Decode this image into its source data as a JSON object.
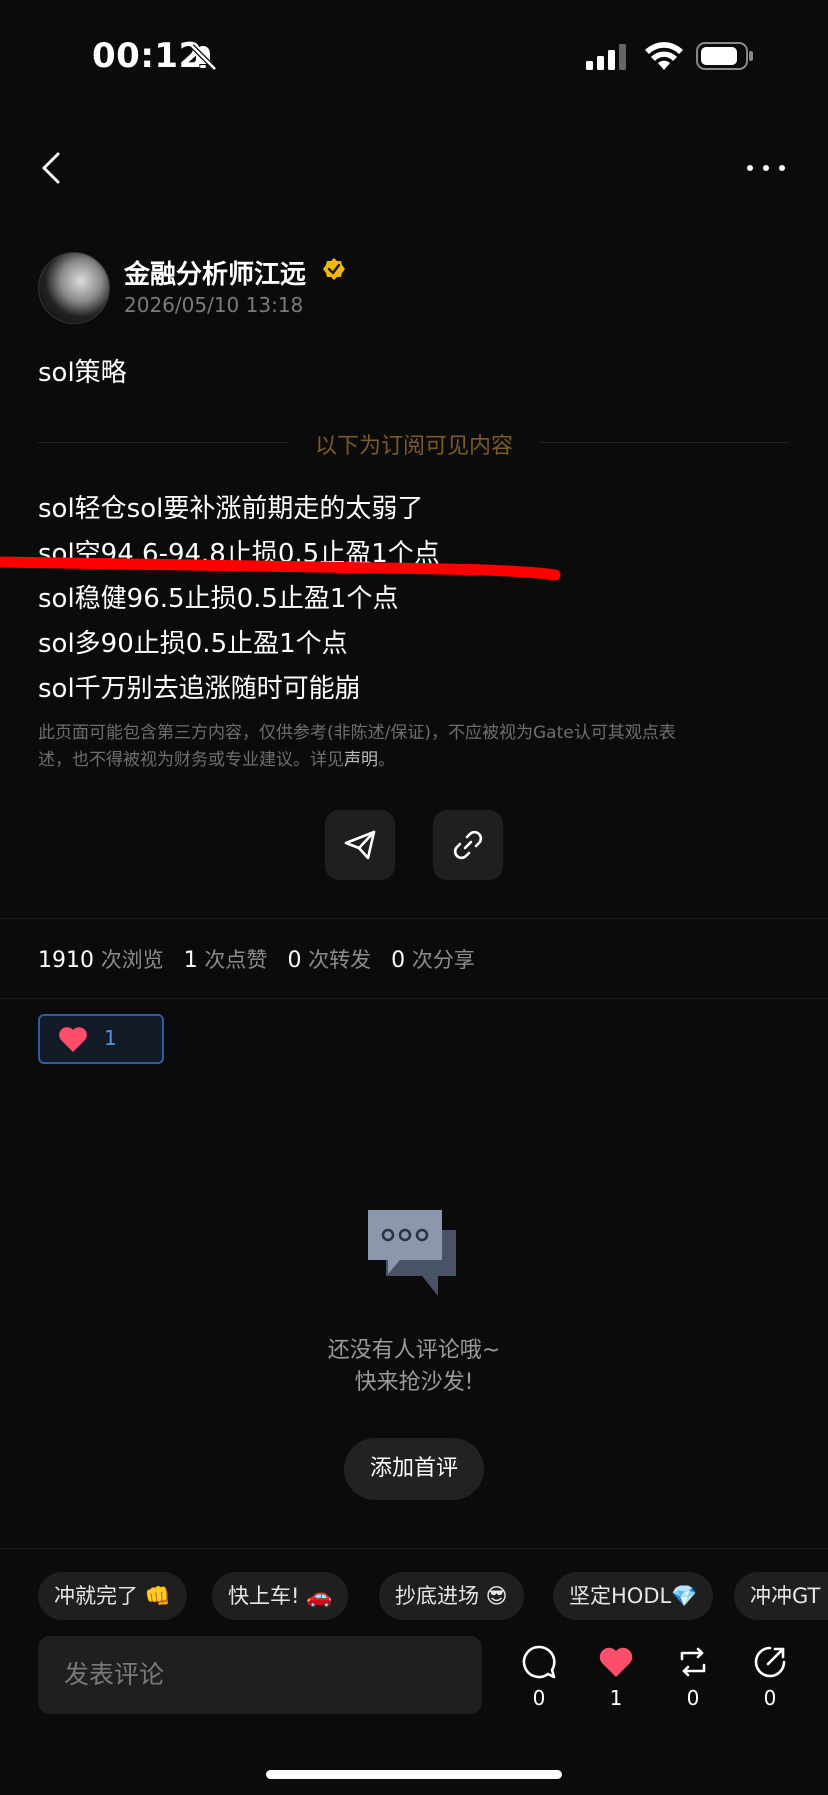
{
  "status": {
    "time": "00:12"
  },
  "post": {
    "author": "金融分析师江远",
    "date": "2026/05/10 13:18",
    "title": "sol策略",
    "subscription_label": "以下为订阅可见内容",
    "lines": [
      "sol轻仓sol要补涨前期走的太弱了",
      "sol空94.6-94.8止损0.5止盈1个点",
      "sol稳健96.5止损0.5止盈1个点",
      "sol多90止损0.5止盈1个点",
      "sol千万别去追涨随时可能崩"
    ],
    "disclaimer_line1": "此页面可能包含第三方内容，仅供参考(非陈述/保证)，不应被视为Gate认可其观点表",
    "disclaimer_line2": "述，也不得被视为财务或专业建议。详见",
    "disclaimer_link": "声明",
    "disclaimer_end": "。"
  },
  "stats": {
    "views": "1910",
    "views_label": "次浏览",
    "likes": "1",
    "likes_label": "次点赞",
    "reposts": "0",
    "reposts_label": "次转发",
    "shares": "0",
    "shares_label": "次分享"
  },
  "reaction": {
    "count": "1"
  },
  "empty": {
    "line1": "还没有人评论哦~",
    "line2": "快来抢沙发!",
    "button": "添加首评"
  },
  "quick_replies": [
    "冲就完了 👊",
    "快上车! 🚗",
    "抄底进场 😎",
    "坚定HODL💎",
    "冲冲GT"
  ],
  "composer": {
    "placeholder": "发表评论",
    "comment_count": "0",
    "like_count": "1",
    "repost_count": "0",
    "share_count": "0"
  },
  "colors": {
    "accent_gold": "#7a5a2b",
    "like_red": "#ff4d6a",
    "annotation_red": "#ff0000",
    "likebox_border": "#2d5ea5"
  }
}
